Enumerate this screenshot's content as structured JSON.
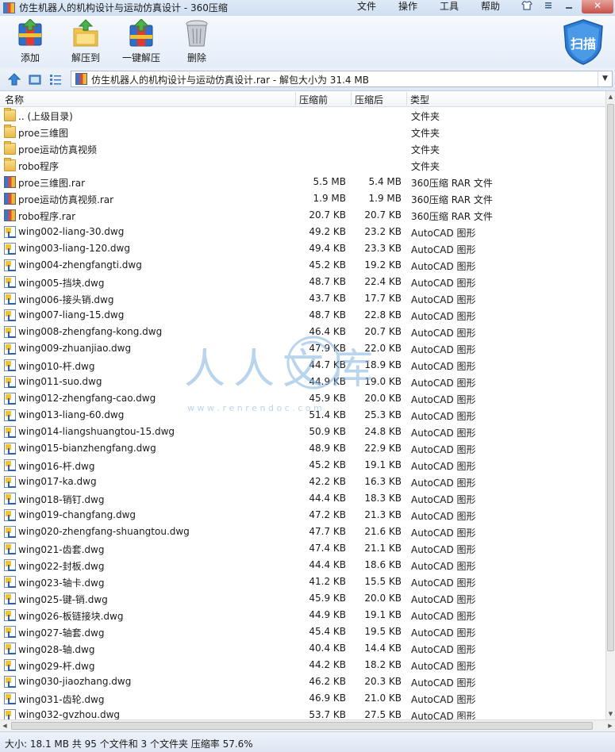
{
  "titlebar": {
    "title": "仿生机器人的机构设计与运动仿真设计 - 360压缩",
    "menu": [
      "文件",
      "操作",
      "工具",
      "帮助"
    ]
  },
  "toolbar": {
    "add": "添加",
    "extract_to": "解压到",
    "one_click_extract": "一键解压",
    "delete": "删除",
    "scan": "扫描"
  },
  "address": {
    "path": "仿生机器人的机构设计与运动仿真设计.rar - 解包大小为 31.4 MB"
  },
  "columns": {
    "name": "名称",
    "original": "压缩前",
    "compressed": "压缩后",
    "type": "类型"
  },
  "files": [
    {
      "icon": "folder-icon",
      "name": ".. (上级目录)",
      "orig": "",
      "comp": "",
      "type": "文件夹"
    },
    {
      "icon": "folder-icon",
      "name": "proe三维图",
      "orig": "",
      "comp": "",
      "type": "文件夹"
    },
    {
      "icon": "folder-icon",
      "name": "proe运动仿真视频",
      "orig": "",
      "comp": "",
      "type": "文件夹"
    },
    {
      "icon": "folder-icon",
      "name": "robo程序",
      "orig": "",
      "comp": "",
      "type": "文件夹"
    },
    {
      "icon": "rar-icon",
      "name": "proe三维图.rar",
      "orig": "5.5 MB",
      "comp": "5.4 MB",
      "type": "360压缩 RAR 文件"
    },
    {
      "icon": "rar-icon",
      "name": "proe运动仿真视频.rar",
      "orig": "1.9 MB",
      "comp": "1.9 MB",
      "type": "360压缩 RAR 文件"
    },
    {
      "icon": "rar-icon",
      "name": "robo程序.rar",
      "orig": "20.7 KB",
      "comp": "20.7 KB",
      "type": "360压缩 RAR 文件"
    },
    {
      "icon": "dwg-icon",
      "name": "wing002-liang-30.dwg",
      "orig": "49.2 KB",
      "comp": "23.2 KB",
      "type": "AutoCAD 图形"
    },
    {
      "icon": "dwg-icon",
      "name": "wing003-liang-120.dwg",
      "orig": "49.4 KB",
      "comp": "23.3 KB",
      "type": "AutoCAD 图形"
    },
    {
      "icon": "dwg-icon",
      "name": "wing004-zhengfangti.dwg",
      "orig": "45.2 KB",
      "comp": "19.2 KB",
      "type": "AutoCAD 图形"
    },
    {
      "icon": "dwg-icon",
      "name": "wing005-挡块.dwg",
      "orig": "48.7 KB",
      "comp": "22.4 KB",
      "type": "AutoCAD 图形"
    },
    {
      "icon": "dwg-icon",
      "name": "wing006-接头销.dwg",
      "orig": "43.7 KB",
      "comp": "17.7 KB",
      "type": "AutoCAD 图形"
    },
    {
      "icon": "dwg-icon",
      "name": "wing007-liang-15.dwg",
      "orig": "48.7 KB",
      "comp": "22.8 KB",
      "type": "AutoCAD 图形"
    },
    {
      "icon": "dwg-icon",
      "name": "wing008-zhengfang-kong.dwg",
      "orig": "46.4 KB",
      "comp": "20.7 KB",
      "type": "AutoCAD 图形"
    },
    {
      "icon": "dwg-icon",
      "name": "wing009-zhuanjiao.dwg",
      "orig": "47.9 KB",
      "comp": "22.0 KB",
      "type": "AutoCAD 图形"
    },
    {
      "icon": "dwg-icon",
      "name": "wing010-杆.dwg",
      "orig": "44.7 KB",
      "comp": "18.9 KB",
      "type": "AutoCAD 图形"
    },
    {
      "icon": "dwg-icon",
      "name": "wing011-suo.dwg",
      "orig": "44.9 KB",
      "comp": "19.0 KB",
      "type": "AutoCAD 图形"
    },
    {
      "icon": "dwg-icon",
      "name": "wing012-zhengfang-cao.dwg",
      "orig": "45.9 KB",
      "comp": "20.0 KB",
      "type": "AutoCAD 图形"
    },
    {
      "icon": "dwg-icon",
      "name": "wing013-liang-60.dwg",
      "orig": "51.4 KB",
      "comp": "25.3 KB",
      "type": "AutoCAD 图形"
    },
    {
      "icon": "dwg-icon",
      "name": "wing014-liangshuangtou-15.dwg",
      "orig": "50.9 KB",
      "comp": "24.8 KB",
      "type": "AutoCAD 图形"
    },
    {
      "icon": "dwg-icon",
      "name": "wing015-bianzhengfang.dwg",
      "orig": "48.9 KB",
      "comp": "22.9 KB",
      "type": "AutoCAD 图形"
    },
    {
      "icon": "dwg-icon",
      "name": "wing016-杆.dwg",
      "orig": "45.2 KB",
      "comp": "19.1 KB",
      "type": "AutoCAD 图形"
    },
    {
      "icon": "dwg-icon",
      "name": "wing017-ka.dwg",
      "orig": "42.2 KB",
      "comp": "16.3 KB",
      "type": "AutoCAD 图形"
    },
    {
      "icon": "dwg-icon",
      "name": "wing018-销钉.dwg",
      "orig": "44.4 KB",
      "comp": "18.3 KB",
      "type": "AutoCAD 图形"
    },
    {
      "icon": "dwg-icon",
      "name": "wing019-changfang.dwg",
      "orig": "47.2 KB",
      "comp": "21.3 KB",
      "type": "AutoCAD 图形"
    },
    {
      "icon": "dwg-icon",
      "name": "wing020-zhengfang-shuangtou.dwg",
      "orig": "47.7 KB",
      "comp": "21.6 KB",
      "type": "AutoCAD 图形"
    },
    {
      "icon": "dwg-icon",
      "name": "wing021-齿套.dwg",
      "orig": "47.4 KB",
      "comp": "21.1 KB",
      "type": "AutoCAD 图形"
    },
    {
      "icon": "dwg-icon",
      "name": "wing022-封板.dwg",
      "orig": "44.4 KB",
      "comp": "18.6 KB",
      "type": "AutoCAD 图形"
    },
    {
      "icon": "dwg-icon",
      "name": "wing023-轴卡.dwg",
      "orig": "41.2 KB",
      "comp": "15.5 KB",
      "type": "AutoCAD 图形"
    },
    {
      "icon": "dwg-icon",
      "name": "wing025-键-销.dwg",
      "orig": "45.9 KB",
      "comp": "20.0 KB",
      "type": "AutoCAD 图形"
    },
    {
      "icon": "dwg-icon",
      "name": "wing026-板链接块.dwg",
      "orig": "44.9 KB",
      "comp": "19.1 KB",
      "type": "AutoCAD 图形"
    },
    {
      "icon": "dwg-icon",
      "name": "wing027-轴套.dwg",
      "orig": "45.4 KB",
      "comp": "19.5 KB",
      "type": "AutoCAD 图形"
    },
    {
      "icon": "dwg-icon",
      "name": "wing028-轴.dwg",
      "orig": "40.4 KB",
      "comp": "14.4 KB",
      "type": "AutoCAD 图形"
    },
    {
      "icon": "dwg-icon",
      "name": "wing029-杆.dwg",
      "orig": "44.2 KB",
      "comp": "18.2 KB",
      "type": "AutoCAD 图形"
    },
    {
      "icon": "dwg-icon",
      "name": "wing030-jiaozhang.dwg",
      "orig": "46.2 KB",
      "comp": "20.3 KB",
      "type": "AutoCAD 图形"
    },
    {
      "icon": "dwg-icon",
      "name": "wing031-齿轮.dwg",
      "orig": "46.9 KB",
      "comp": "21.0 KB",
      "type": "AutoCAD 图形"
    },
    {
      "icon": "dwg-icon",
      "name": "wing032-gvzhou.dwg",
      "orig": "53.7 KB",
      "comp": "27.5 KB",
      "type": "AutoCAD 图形"
    }
  ],
  "status": {
    "text": "大小: 18.1 MB 共 95 个文件和 3 个文件夹 压缩率 57.6%"
  },
  "watermark": {
    "text": "人人文库",
    "url": "w w w . r e n r e n d o c . c o m"
  }
}
